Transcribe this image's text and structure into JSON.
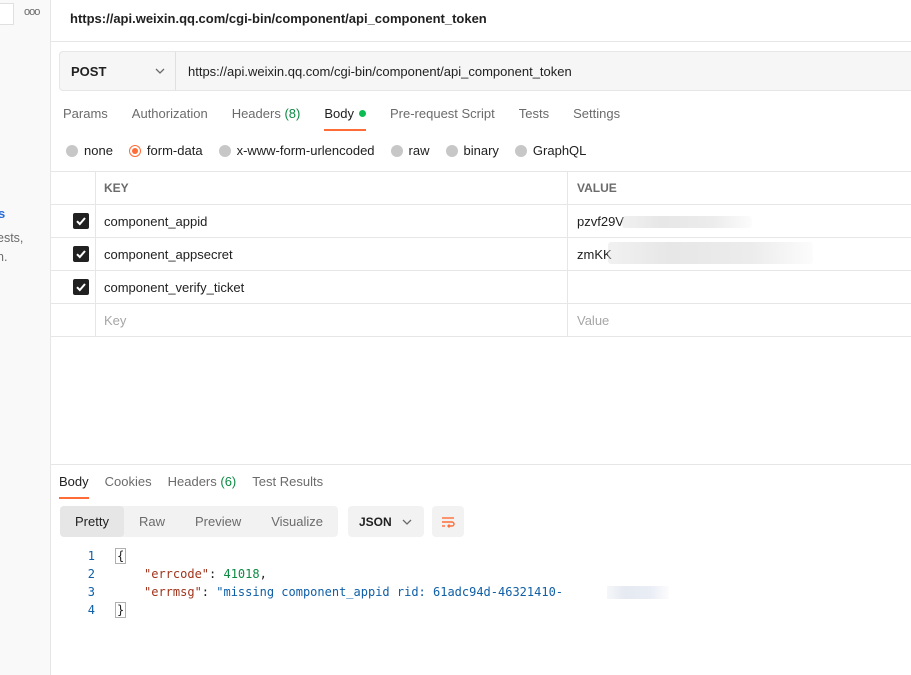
{
  "sidebar": {
    "more_label": "ooo",
    "fragment_heading": "s",
    "fragment_line1": "ests,",
    "fragment_line2": "n."
  },
  "request": {
    "title": "https://api.weixin.qq.com/cgi-bin/component/api_component_token",
    "method": "POST",
    "url": "https://api.weixin.qq.com/cgi-bin/component/api_component_token"
  },
  "request_tabs": [
    {
      "label": "Params"
    },
    {
      "label": "Authorization"
    },
    {
      "label": "Headers",
      "count": "(8)"
    },
    {
      "label": "Body"
    },
    {
      "label": "Pre-request Script"
    },
    {
      "label": "Tests"
    },
    {
      "label": "Settings"
    }
  ],
  "body_types": [
    "none",
    "form-data",
    "x-www-form-urlencoded",
    "raw",
    "binary",
    "GraphQL"
  ],
  "body_type_selected": "form-data",
  "params_table": {
    "key_header": "KEY",
    "value_header": "VALUE",
    "rows": [
      {
        "key": "component_appid",
        "value": "pzvf29V",
        "checked": true
      },
      {
        "key": "component_appsecret",
        "value": "zmKK",
        "checked": true
      },
      {
        "key": "component_verify_ticket",
        "value": "",
        "checked": true
      }
    ],
    "key_placeholder": "Key",
    "value_placeholder": "Value"
  },
  "response_tabs": [
    {
      "label": "Body"
    },
    {
      "label": "Cookies"
    },
    {
      "label": "Headers",
      "count": "(6)"
    },
    {
      "label": "Test Results"
    }
  ],
  "view_modes": [
    "Pretty",
    "Raw",
    "Preview",
    "Visualize"
  ],
  "view_mode_selected": "Pretty",
  "format": "JSON",
  "response_body": {
    "line_numbers": [
      "1",
      "2",
      "3",
      "4"
    ],
    "open_brace": "{",
    "close_brace": "}",
    "errcode_key": "\"errcode\"",
    "errcode_value": "41018",
    "errmsg_key": "\"errmsg\"",
    "errmsg_value": "\"missing component_appid rid: 61adc94d-46321410-"
  },
  "colors": {
    "accent": "#ff6c37",
    "status_green": "#0cbb52"
  }
}
